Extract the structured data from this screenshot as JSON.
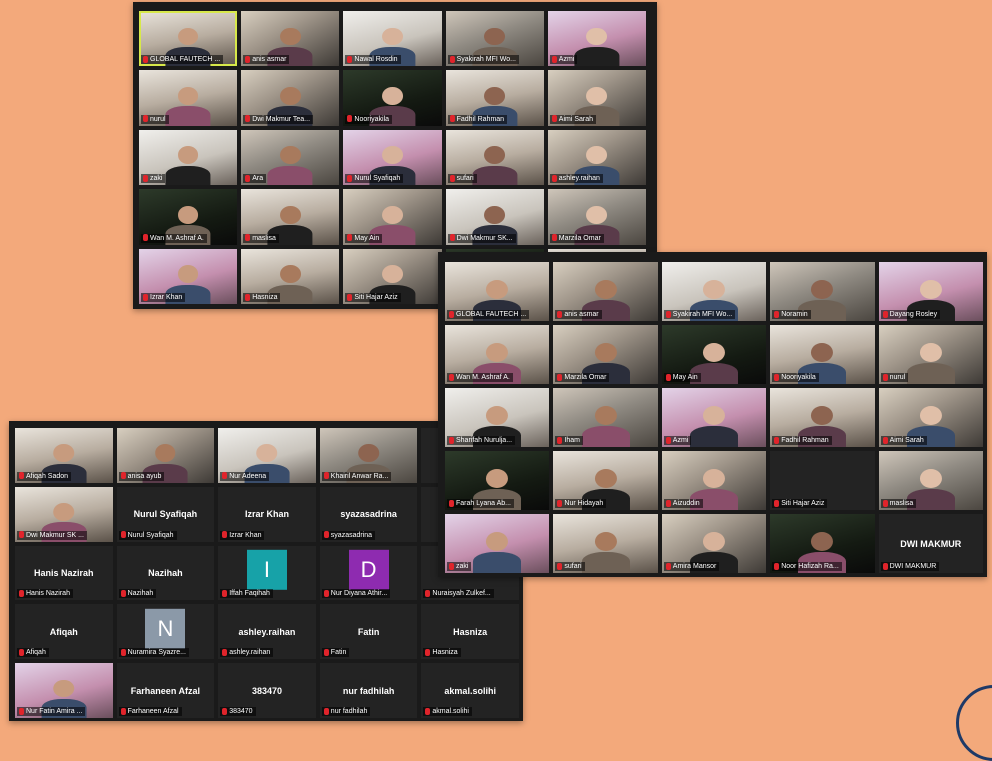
{
  "colors": {
    "background": "#f3a97b",
    "window": "#1a1a1a",
    "mic_muted": "#e0242b",
    "active_border": "#d7e84a"
  },
  "window_top": {
    "tiles": [
      {
        "name": "GLOBAL FAUTECH ...",
        "kind": "video",
        "active": true
      },
      {
        "name": "anis asmar",
        "kind": "video"
      },
      {
        "name": "Nawal Rosdin",
        "kind": "video"
      },
      {
        "name": "Syakirah MFI Wo...",
        "kind": "video"
      },
      {
        "name": "Azmi",
        "kind": "video"
      },
      {
        "name": "nurul",
        "kind": "video"
      },
      {
        "name": "Dwi Makmur Tea...",
        "kind": "video"
      },
      {
        "name": "Nooriyakila",
        "kind": "video"
      },
      {
        "name": "Fadhil Rahman",
        "kind": "video"
      },
      {
        "name": "Aimi Sarah",
        "kind": "video"
      },
      {
        "name": "zaki",
        "kind": "video"
      },
      {
        "name": "Ara",
        "kind": "video"
      },
      {
        "name": "Nurul Syafiqah",
        "kind": "video"
      },
      {
        "name": "sufari",
        "kind": "video"
      },
      {
        "name": "ashley.raihan",
        "kind": "video"
      },
      {
        "name": "Wan M. Ashraf A.",
        "kind": "video"
      },
      {
        "name": "maslisa",
        "kind": "video"
      },
      {
        "name": "May Ain",
        "kind": "video"
      },
      {
        "name": "Dwi Makmur SK...",
        "kind": "video"
      },
      {
        "name": "Marzila Omar",
        "kind": "video"
      },
      {
        "name": "Izrar Khan",
        "kind": "video"
      },
      {
        "name": "Hasniza",
        "kind": "video"
      },
      {
        "name": "Siti Hajar Aziz",
        "kind": "video"
      },
      {
        "name": "Noor Hafizah Ra...",
        "kind": "video"
      },
      {
        "name": "Nur Adeena",
        "kind": "video"
      }
    ]
  },
  "window_right": {
    "tiles": [
      {
        "name": "GLOBAL FAUTECH ...",
        "kind": "video"
      },
      {
        "name": "anis asmar",
        "kind": "video"
      },
      {
        "name": "Syakirah MFI Wo...",
        "kind": "video"
      },
      {
        "name": "Noramin",
        "kind": "video"
      },
      {
        "name": "Dayang Rosley",
        "kind": "video"
      },
      {
        "name": "Wan M. Ashraf A.",
        "kind": "video"
      },
      {
        "name": "Marzila Omar",
        "kind": "video"
      },
      {
        "name": "May Ain",
        "kind": "video"
      },
      {
        "name": "Nooriyakila",
        "kind": "video"
      },
      {
        "name": "nurul",
        "kind": "video"
      },
      {
        "name": "Sharifah Nurulja...",
        "kind": "video"
      },
      {
        "name": "Iham",
        "kind": "video"
      },
      {
        "name": "Azmi",
        "kind": "video"
      },
      {
        "name": "Fadhil Rahman",
        "kind": "video"
      },
      {
        "name": "Aimi Sarah",
        "kind": "video"
      },
      {
        "name": "Farah Lyana Ab...",
        "kind": "video"
      },
      {
        "name": "Nur Hidayah",
        "kind": "video"
      },
      {
        "name": "Aizuddin",
        "kind": "video"
      },
      {
        "name": "Siti Hajar Aziz",
        "kind": "name"
      },
      {
        "name": "maslisa",
        "kind": "video"
      },
      {
        "name": "zaki",
        "kind": "video"
      },
      {
        "name": "sufari",
        "kind": "video"
      },
      {
        "name": "Amira Mansor",
        "kind": "video"
      },
      {
        "name": "Noor Hafizah Ra...",
        "kind": "video"
      },
      {
        "name": "DWI MAKMUR",
        "kind": "name",
        "big": "DWI MAKMUR"
      }
    ]
  },
  "window_left": {
    "tiles": [
      {
        "name": "Afiqah Sadon",
        "kind": "video"
      },
      {
        "name": "anisa ayub",
        "kind": "video"
      },
      {
        "name": "Nur Adeena",
        "kind": "video"
      },
      {
        "name": "Khairil Anwar Ra...",
        "kind": "video"
      },
      {
        "name": "",
        "kind": "blank"
      },
      {
        "name": "Dwi Makmur SK ...",
        "kind": "video"
      },
      {
        "name": "Nurul Syafiqah",
        "kind": "name",
        "big": "Nurul Syafiqah"
      },
      {
        "name": "Izrar Khan",
        "kind": "name",
        "big": "Izrar Khan"
      },
      {
        "name": "syazasadrina",
        "kind": "name",
        "big": "syazasadrina"
      },
      {
        "name": "",
        "kind": "blank"
      },
      {
        "name": "Hanis Nazirah",
        "kind": "name",
        "big": "Hanis Nazirah"
      },
      {
        "name": "Nazihah",
        "kind": "name",
        "big": "Nazihah"
      },
      {
        "name": "Iffah Faqihah",
        "kind": "avatar",
        "letter": "I",
        "color": "#17a2a8"
      },
      {
        "name": "Nur Diyana Athir...",
        "kind": "avatar",
        "letter": "D",
        "color": "#8e2bb0"
      },
      {
        "name": "Nuraisyah Zulkef...",
        "kind": "name"
      },
      {
        "name": "Afiqah",
        "kind": "name",
        "big": "Afiqah"
      },
      {
        "name": "Nuramira Syazre...",
        "kind": "avatar",
        "letter": "N",
        "color": "#8b99a8"
      },
      {
        "name": "ashley.raihan",
        "kind": "name",
        "big": "ashley.raihan"
      },
      {
        "name": "Fatin",
        "kind": "name",
        "big": "Fatin"
      },
      {
        "name": "Hasniza",
        "kind": "name",
        "big": "Hasniza"
      },
      {
        "name": "Nur Fatin Amira ...",
        "kind": "video"
      },
      {
        "name": "Farhaneen Afzal",
        "kind": "name",
        "big": "Farhaneen Afzal"
      },
      {
        "name": "383470",
        "kind": "name",
        "big": "383470"
      },
      {
        "name": "nur fadhilah",
        "kind": "name",
        "big": "nur fadhilah"
      },
      {
        "name": "akmal.solihi",
        "kind": "name",
        "big": "akmal.solihi"
      }
    ]
  }
}
